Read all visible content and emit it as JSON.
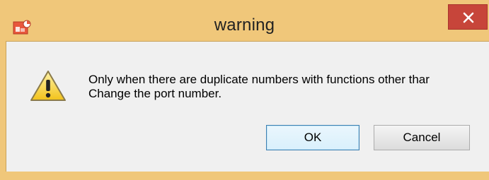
{
  "window": {
    "title": "warning",
    "frame_color": "#f0c77a",
    "close_button_color": "#c7453a"
  },
  "icons": {
    "app": "application-icon",
    "close": "close-icon",
    "message": "warning-icon"
  },
  "message": {
    "line1": "Only when there are duplicate numbers with functions other thar",
    "line2": "Change the port number."
  },
  "buttons": {
    "ok_label": "OK",
    "cancel_label": "Cancel"
  }
}
